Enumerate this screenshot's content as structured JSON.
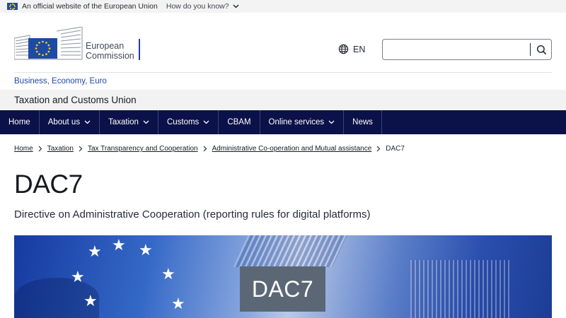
{
  "eu_banner": {
    "official_text": "An official website of the European Union",
    "how_know": "How do you know?"
  },
  "header": {
    "logo_line1": "European",
    "logo_line2": "Commission",
    "language": "EN",
    "search_placeholder": ""
  },
  "site": {
    "dg_links": "Business, Economy, Euro",
    "name": "Taxation and Customs Union"
  },
  "nav": {
    "items": [
      {
        "label": "Home",
        "has_dropdown": false
      },
      {
        "label": "About us",
        "has_dropdown": true
      },
      {
        "label": "Taxation",
        "has_dropdown": true
      },
      {
        "label": "Customs",
        "has_dropdown": true
      },
      {
        "label": "CBAM",
        "has_dropdown": false
      },
      {
        "label": "Online services",
        "has_dropdown": true
      },
      {
        "label": "News",
        "has_dropdown": false
      }
    ]
  },
  "breadcrumb": {
    "items": [
      "Home",
      "Taxation",
      "Tax Transparency and Cooperation",
      "Administrative Co-operation and Mutual assistance"
    ],
    "current": "DAC7"
  },
  "page": {
    "title": "DAC7",
    "subtitle": "Directive on Administrative Cooperation (reporting rules for digital platforms)",
    "hero_label": "DAC7"
  },
  "colors": {
    "nav_bg": "#0b1149",
    "link_blue": "#2048a6",
    "eu_blue": "#1d4aa5",
    "eu_yellow": "#ffd617"
  }
}
